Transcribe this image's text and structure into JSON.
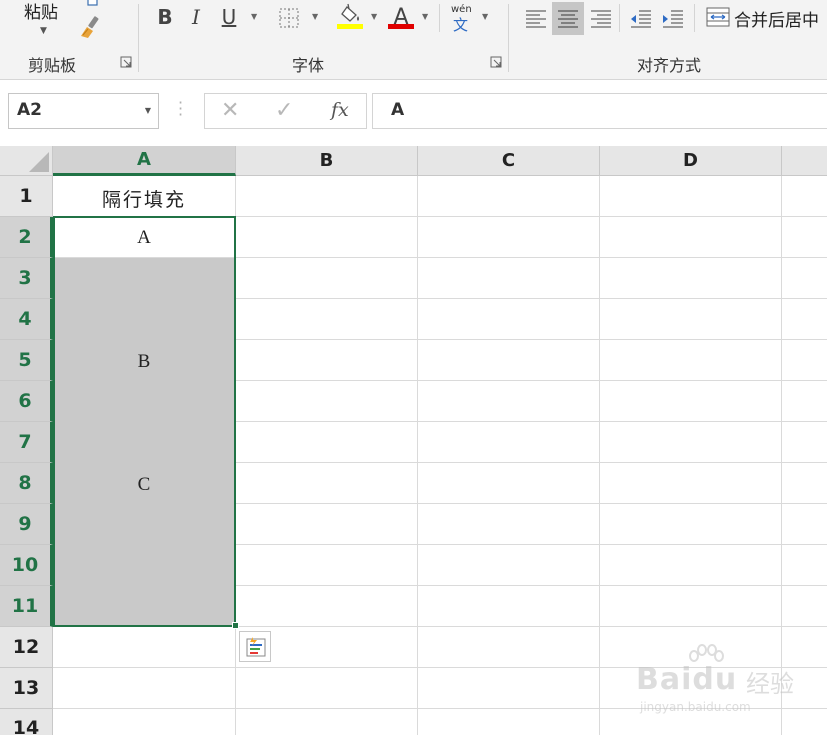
{
  "ribbon": {
    "clipboard": {
      "paste_label": "粘贴",
      "group_label": "剪贴板"
    },
    "font": {
      "bold_label": "B",
      "italic_label": "I",
      "underline_label": "U",
      "font_color_label": "A",
      "phonetic_top": "wén",
      "phonetic_bottom": "文",
      "group_label": "字体",
      "fill_color": "#ffff00",
      "font_color": "#e00000"
    },
    "alignment": {
      "merge_label": "合并后居中",
      "group_label": "对齐方式"
    }
  },
  "formula_bar": {
    "name_box": "A2",
    "fx_label": "fx",
    "formula": "A"
  },
  "grid": {
    "columns": [
      "A",
      "B",
      "C",
      "D"
    ],
    "rows": [
      "1",
      "2",
      "3",
      "4",
      "5",
      "6",
      "7",
      "8",
      "9",
      "10",
      "11",
      "12",
      "13",
      "14"
    ],
    "cells": {
      "A1": "隔行填充",
      "A2": "A",
      "B_merged": "B",
      "C_merged": "C"
    },
    "selected_range": "A2:A11",
    "accent_color": "#217346",
    "fill_gray": "#c9c9c9"
  },
  "watermark": {
    "brand": "Baidu",
    "brand_cn": "经验",
    "url": "jingyan.baidu.com"
  }
}
